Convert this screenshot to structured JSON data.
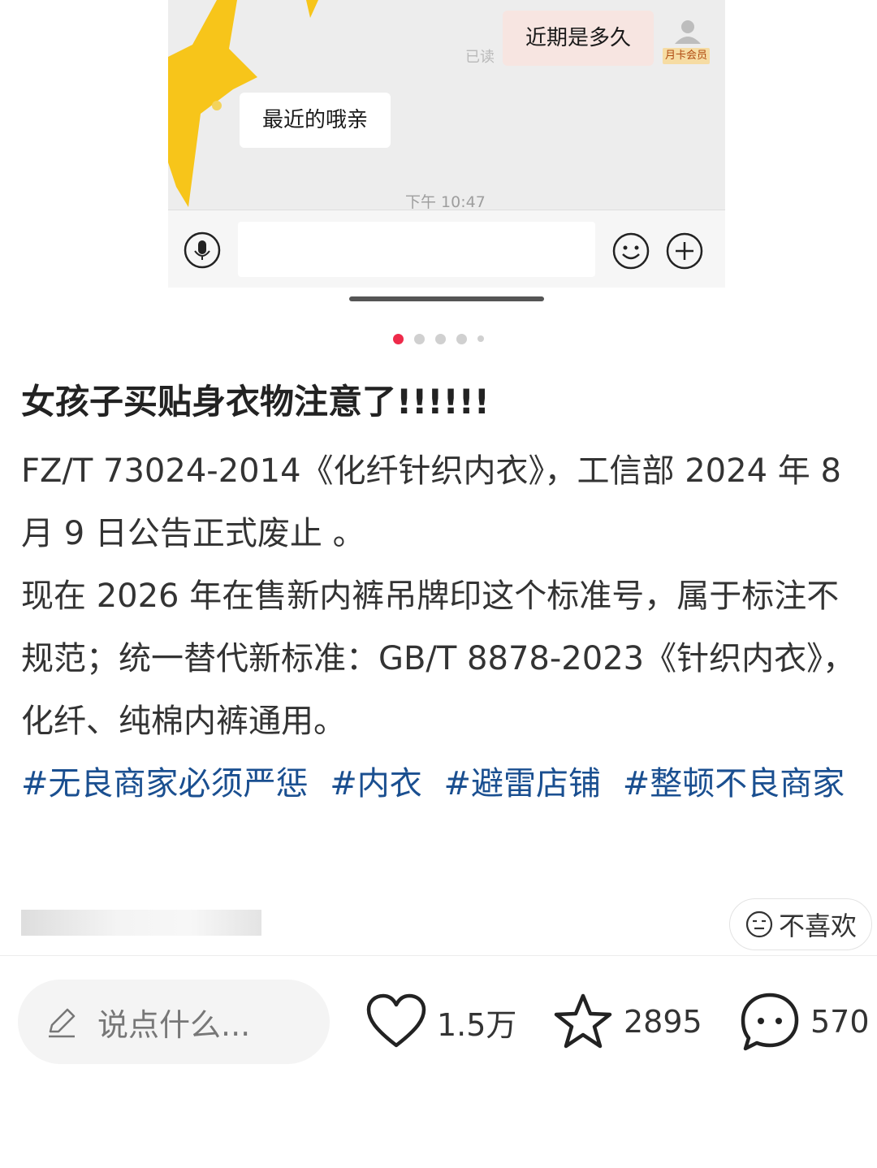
{
  "chat_screenshot": {
    "outgoing_message": "近期是多久",
    "read_status": "已读",
    "member_badge": "月卡会员",
    "incoming_message": "最近的哦亲",
    "time": "下午 10:47"
  },
  "carousel": {
    "count": 5,
    "active_index": 0
  },
  "post": {
    "title": "女孩子买贴身衣物注意了!!!!!!",
    "paragraph_1": "FZ/T 73024-2014《化纤针织内衣》，工信部 2024 年 8 月 9 日公告正式废止 。",
    "paragraph_2": "现在 2026 年在售新内裤吊牌印这个标准号，属于标注不规范；统一替代新标准：GB/T 8878-2023《针织内衣》，化纤、纯棉内裤通用。",
    "tags": [
      "#无良商家必须严惩",
      "#内衣",
      "#避雷店铺",
      "#整顿不良商家"
    ]
  },
  "dislike_label": "不喜欢",
  "bottom_bar": {
    "comment_placeholder": "说点什么...",
    "likes": "1.5万",
    "collects": "2895",
    "comments": "570"
  },
  "colors": {
    "accent": "#ee2a4a",
    "tag": "#1a4f90",
    "splash": "#f7c51a"
  }
}
